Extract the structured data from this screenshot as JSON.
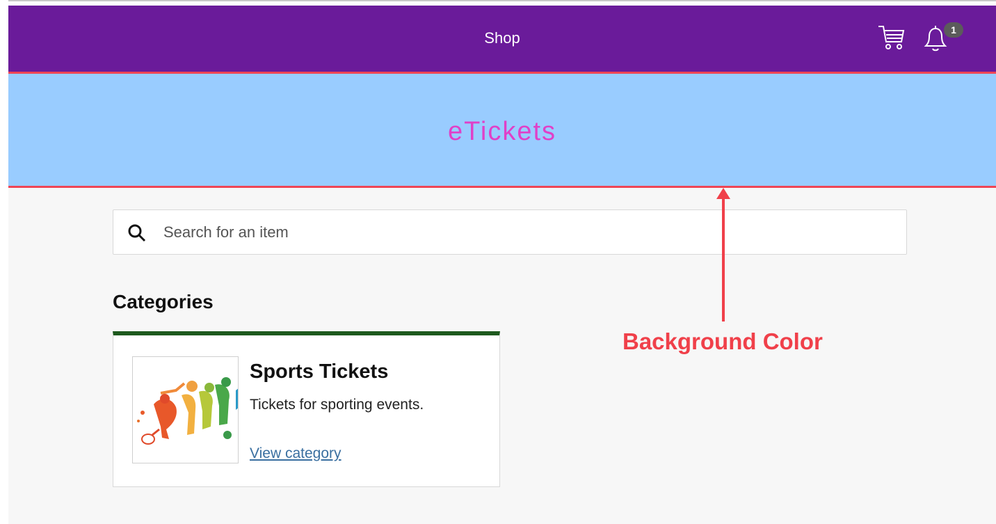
{
  "header": {
    "title": "Shop",
    "cart_icon": "cart-icon",
    "notifications_icon": "bell-icon",
    "notification_count": "1"
  },
  "banner": {
    "title": "eTickets"
  },
  "search": {
    "placeholder": "Search for an item",
    "value": "",
    "icon": "search-icon"
  },
  "categories": {
    "heading": "Categories",
    "items": [
      {
        "title": "Sports Tickets",
        "description": "Tickets for sporting events.",
        "link_label": "View category"
      }
    ]
  },
  "annotation": {
    "label": "Background Color"
  },
  "colors": {
    "topbar": "#6a1b9a",
    "banner_background": "#99ccff",
    "banner_title": "#e040c8",
    "border_accent": "#ef4555",
    "card_accent": "#1e5a1e",
    "annotation": "#f0404a",
    "link": "#3a6fa0"
  }
}
